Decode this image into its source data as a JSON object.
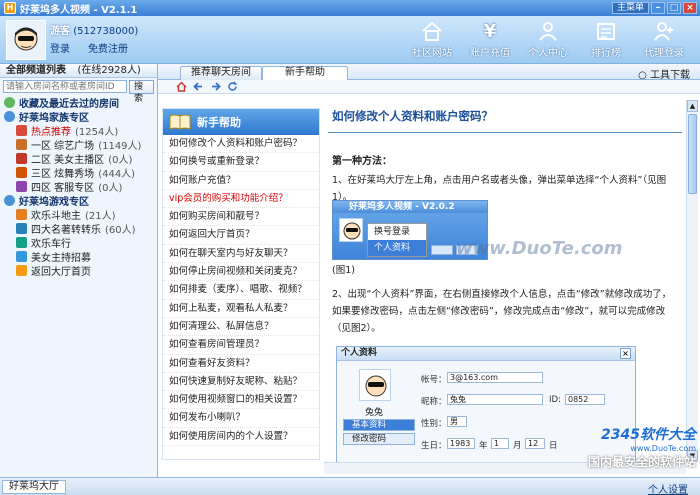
{
  "window": {
    "title": "好莱坞多人视频 - V2.1.1",
    "main_menu": "主菜单",
    "min_btn": "–",
    "max_btn": "□",
    "close_btn": "×"
  },
  "user": {
    "nickname": "游客",
    "uid": "(512738000)",
    "login_label": "登录",
    "register_label": "免费注册"
  },
  "top_tools": [
    {
      "label": "社区网站",
      "icon": "house-icon"
    },
    {
      "label": "账户充值",
      "icon": "money-icon"
    },
    {
      "label": "个人中心",
      "icon": "person-icon"
    },
    {
      "label": "排行榜",
      "icon": "ranking-icon"
    },
    {
      "label": "代理登录",
      "icon": "agent-icon"
    }
  ],
  "left_panel": {
    "header_title": "全部频道列表",
    "online_count": "(在线2928人)",
    "search_placeholder": "请输入房间名称或者房间ID",
    "search_button": "搜索",
    "favorites": "收藏及最近去过的房间",
    "family_zone": "好莱坞家族专区",
    "family_rooms": [
      {
        "label": "热点推荐",
        "count": "(1254人)",
        "color": "#d64b3a"
      },
      {
        "label": "一区 综艺广场",
        "count": "(1149人)",
        "color": "#c8702a"
      },
      {
        "label": "二区 美女主播区",
        "count": "(0人)",
        "color": "#c0392b"
      },
      {
        "label": "三区 炫舞秀场",
        "count": "(444人)",
        "color": "#d35400"
      },
      {
        "label": "四区 客服专区",
        "count": "(0人)",
        "color": "#8e44ad"
      }
    ],
    "game_zone": "好莱坞游戏专区",
    "game_rooms": [
      {
        "label": "欢乐斗地主",
        "count": "(21人)",
        "color": "#e67e22"
      },
      {
        "label": "四大名著转转乐",
        "count": "(60人)",
        "color": "#2980b9"
      },
      {
        "label": "欢乐车行",
        "count": "",
        "color": "#16a085"
      },
      {
        "label": "美女主持招募",
        "count": "",
        "color": "#3498db"
      },
      {
        "label": "返回大厅首页",
        "count": "",
        "color": "#f39c12"
      }
    ]
  },
  "tabs": [
    {
      "label": "推荐聊天房间"
    },
    {
      "label": "新手帮助"
    }
  ],
  "tools_download": "工具下载",
  "help_list": {
    "title": "新手帮助",
    "items": [
      {
        "text": "如何修改个人资料和账户密码？",
        "highlight": false
      },
      {
        "text": "如何换号或重新登录？",
        "highlight": false
      },
      {
        "text": "如何账户充值？",
        "highlight": false
      },
      {
        "text": "vip会员的购买和功能介绍？",
        "highlight": true
      },
      {
        "text": "如何购买房间和靓号？",
        "highlight": false
      },
      {
        "text": "如何返回大厅首页？",
        "highlight": false
      },
      {
        "text": "如何在聊天室内与好友聊天？",
        "highlight": false
      },
      {
        "text": "如何停止房间视频和关闭麦克？",
        "highlight": false
      },
      {
        "text": "如何排麦（麦序）、唱歌、视频？",
        "highlight": false
      },
      {
        "text": "如何上私麦，观看私人私麦？",
        "highlight": false
      },
      {
        "text": "如何清理公、私屏信息？",
        "highlight": false
      },
      {
        "text": "如何查看房间管理员？",
        "highlight": false
      },
      {
        "text": "如何查看好友资料？",
        "highlight": false
      },
      {
        "text": "如何快速复制好友昵称、粘贴？",
        "highlight": false
      },
      {
        "text": "如何使用视频窗口的相关设置？",
        "highlight": false
      },
      {
        "text": "如何发布小喇叭？",
        "highlight": false
      },
      {
        "text": "如何使用房间内的个人设置？",
        "highlight": false
      }
    ]
  },
  "article": {
    "title": "如何修改个人资料和账户密码？",
    "method_title": "第一种方法：",
    "step1": "1、在好莱坞大厅左上角，点击用户名或者头像，弹出菜单选择“个人资料”（见图1）。",
    "fig1_title": "好莱坞多人视频 - V2.0.2",
    "fig1_menu": [
      "换号登录",
      "个人资料"
    ],
    "fig1_caption": "(图1)",
    "step2": "2、出现“个人资料”界面，在右侧直接修改个人信息，点击“修改”就修改成功了，如果要修改密码，点击左侧“修改密码”，修改完成点击“修改”，就可以完成修改（见图2）。",
    "fig2": {
      "title": "个人资料",
      "nickname": "兔兔",
      "tab_basic": "基本资料",
      "tab_password": "修改密码",
      "account_label": "帐号：",
      "account_value": "3@163.com",
      "nick_label": "昵称：",
      "nick_value": "兔兔",
      "id_label": "ID:",
      "id_value": "0852",
      "gender_label": "性别：",
      "gender_value": "男",
      "birthday_label": "生日：",
      "year": "1983",
      "year_unit": "年",
      "month": "1",
      "month_unit": "月",
      "day": "12",
      "day_unit": "日"
    }
  },
  "watermarks": {
    "center": "www.DuoTe.com",
    "brand": "2345软件大全",
    "url": "www.DuoTe.com",
    "slogan": "国内最安全的软件站"
  },
  "status_bar": {
    "tab": "好莱坞大厅",
    "settings": "个人设置"
  },
  "colors": {
    "title_bar": "#3b7fd6",
    "header_bg": "#9ecbf2",
    "accent_link": "#1a4f9a",
    "highlight_red": "#d00000"
  }
}
